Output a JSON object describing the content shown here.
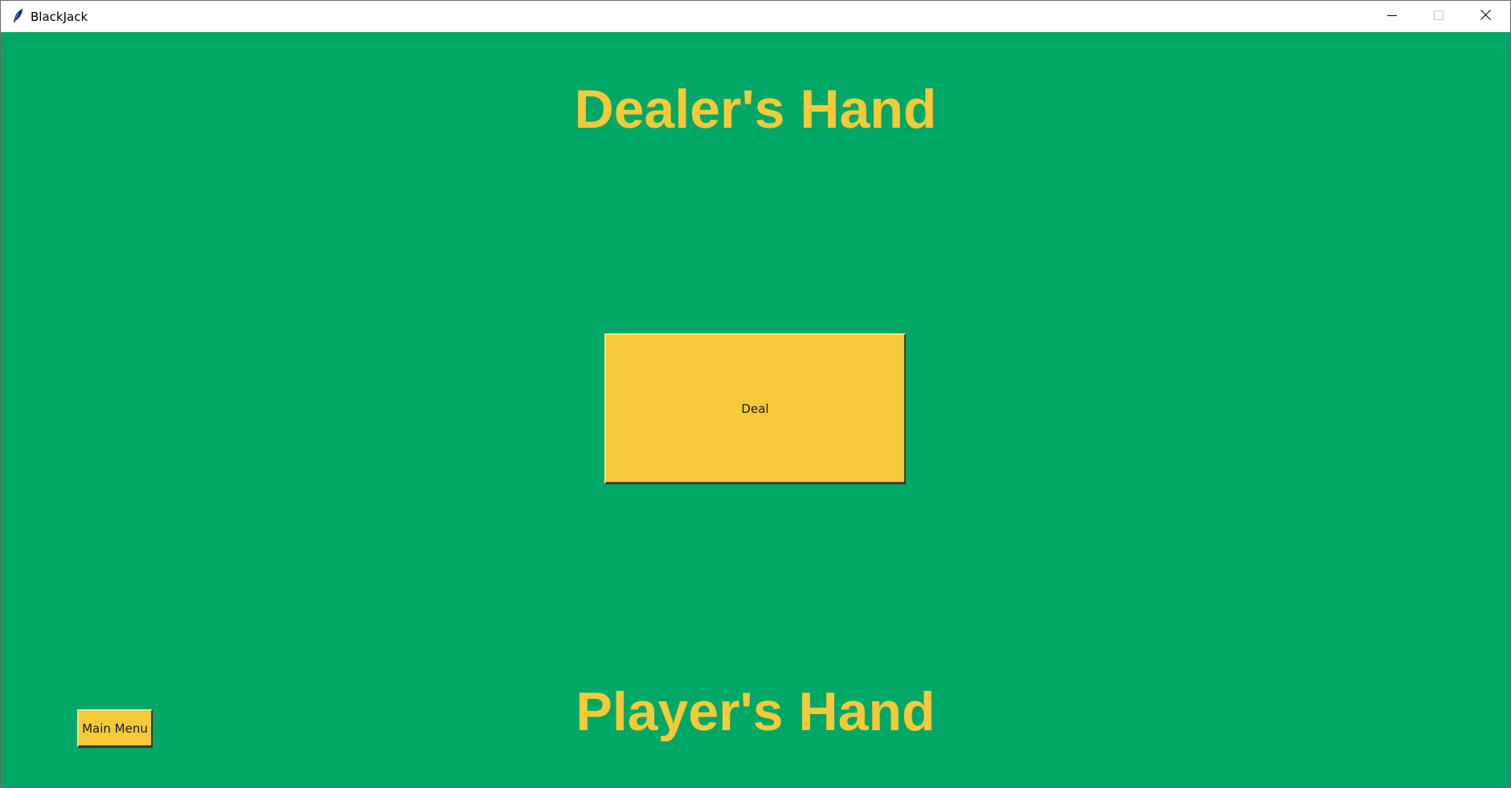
{
  "window": {
    "title": "BlackJack",
    "app_icon": "feather-icon",
    "controls": {
      "minimize_icon": "minimize-icon",
      "maximize_icon": "maximize-icon",
      "close_icon": "close-icon"
    }
  },
  "table": {
    "background_color": "#00a868",
    "accent_color": "#f5c938",
    "dealer_heading": "Dealer's Hand",
    "player_heading": "Player's Hand",
    "deal_label": "Deal",
    "main_menu_label": "Main Menu"
  }
}
